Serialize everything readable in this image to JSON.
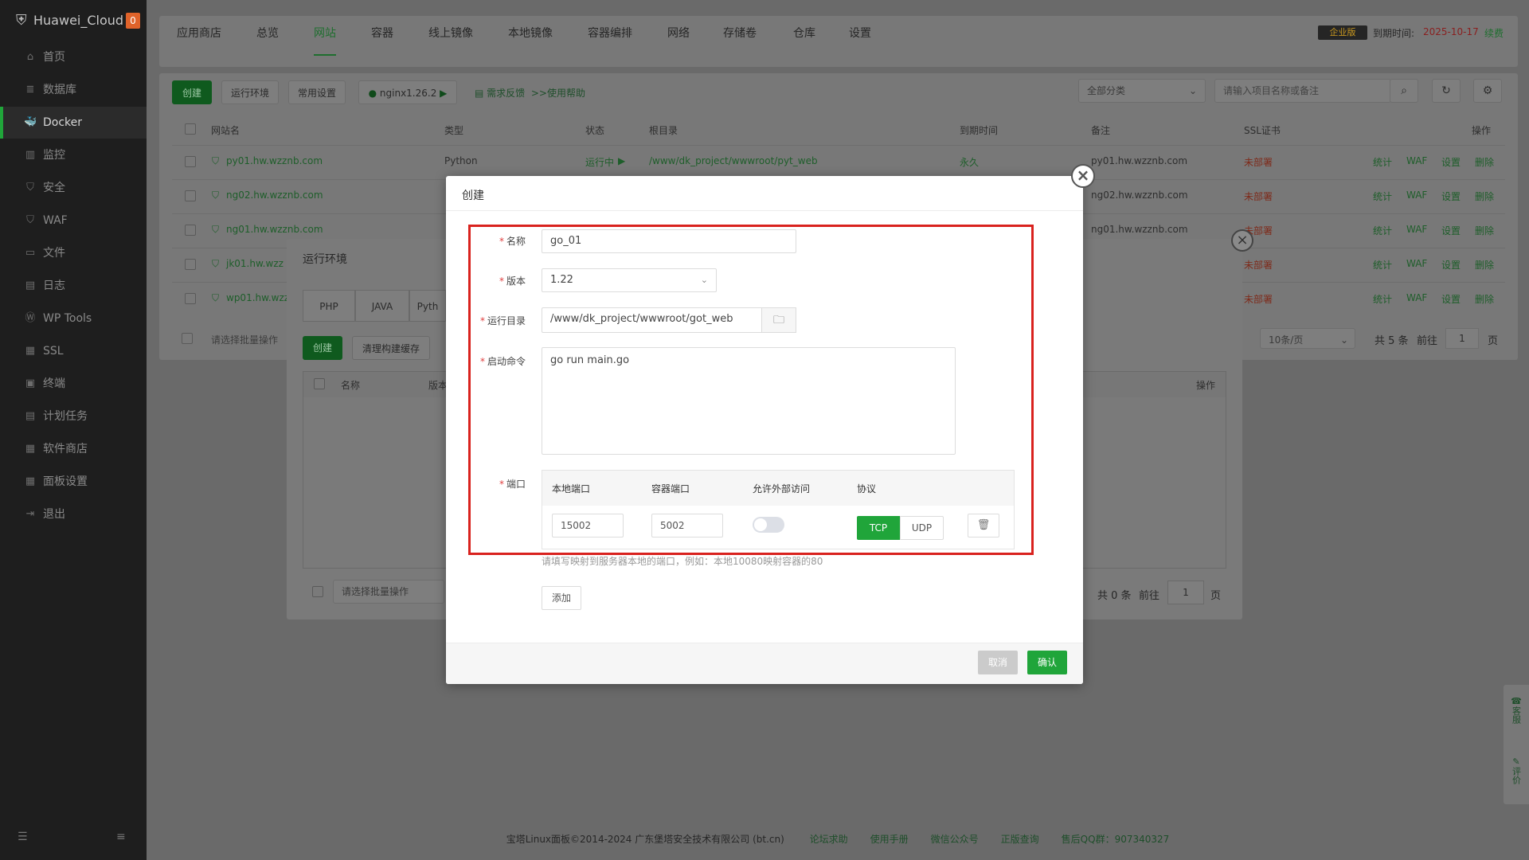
{
  "sidebar": {
    "app_name": "Huawei_Cloud",
    "badge": "0",
    "items": [
      {
        "label": "首页",
        "icon": "home-icon"
      },
      {
        "label": "数据库",
        "icon": "database-icon"
      },
      {
        "label": "Docker",
        "icon": "docker-icon"
      },
      {
        "label": "监控",
        "icon": "monitor-icon"
      },
      {
        "label": "安全",
        "icon": "shield-icon"
      },
      {
        "label": "WAF",
        "icon": "waf-icon"
      },
      {
        "label": "文件",
        "icon": "folder-icon"
      },
      {
        "label": "日志",
        "icon": "log-icon"
      },
      {
        "label": "WP Tools",
        "icon": "wordpress-icon"
      },
      {
        "label": "SSL",
        "icon": "ssl-icon"
      },
      {
        "label": "终端",
        "icon": "terminal-icon"
      },
      {
        "label": "计划任务",
        "icon": "schedule-icon"
      },
      {
        "label": "软件商店",
        "icon": "store-icon"
      },
      {
        "label": "面板设置",
        "icon": "settings-icon"
      },
      {
        "label": "退出",
        "icon": "logout-icon"
      }
    ],
    "active": "Docker"
  },
  "topbar": {
    "tabs": [
      "应用商店",
      "总览",
      "网站",
      "容器",
      "线上镜像",
      "本地镜像",
      "容器编排",
      "网络",
      "存储卷",
      "仓库",
      "设置"
    ],
    "active": "网站",
    "vip": "企业版",
    "expire_label": "到期时间:",
    "expire_date": "2025-10-17",
    "renew": "续费"
  },
  "toolbar": {
    "create": "创建",
    "run_env": "运行环境",
    "common_settings": "常用设置",
    "nginx": "nginx1.26.2",
    "feedback": "需求反馈",
    "help": ">>使用帮助",
    "category": "全部分类",
    "search_placeholder": "请输入项目名称或备注"
  },
  "site_table": {
    "headers": [
      "网站名",
      "类型",
      "状态",
      "根目录",
      "到期时间",
      "备注",
      "SSL证书",
      "操作"
    ],
    "rows": [
      {
        "name": "py01.hw.wzznb.com",
        "type": "Python",
        "status": "运行中",
        "root": "/www/dk_project/wwwroot/pyt_web",
        "expire": "永久",
        "remark": "py01.hw.wzznb.com",
        "ssl": "未部署"
      },
      {
        "name": "ng02.hw.wzznb.com",
        "remark": "ng02.hw.wzznb.com",
        "ssl": "未部署"
      },
      {
        "name": "ng01.hw.wzznb.com",
        "remark": "ng01.hw.wzznb.com",
        "ssl": "未部署"
      },
      {
        "name": "jk01.hw.wzz",
        "ssl": "未部署"
      },
      {
        "name": "wp01.hw.wzz",
        "ssl": "未部署"
      }
    ],
    "actions": [
      "统计",
      "WAF",
      "设置",
      "删除"
    ],
    "batch": "请选择批量操作",
    "page_size": "10条/页",
    "total": "共 5 条",
    "goto": "前往",
    "page": "1",
    "page_unit": "页"
  },
  "env_dialog": {
    "title": "运行环境",
    "tabs": [
      "PHP",
      "JAVA",
      "Pyth"
    ],
    "create": "创建",
    "clear_cache": "清理构建缓存",
    "col_name": "名称",
    "col_version": "版本",
    "col_action": "操作",
    "batch": "请选择批量操作",
    "total": "共 0 条",
    "goto": "前往",
    "page": "1",
    "page_unit": "页"
  },
  "modal": {
    "title": "创建",
    "name_label": "名称",
    "name_value": "go_01",
    "version_label": "版本",
    "version_value": "1.22",
    "dir_label": "运行目录",
    "dir_value": "/www/dk_project/wwwroot/got_web",
    "cmd_label": "启动命令",
    "cmd_value": "go run main.go",
    "port_label": "端口",
    "port_headers": [
      "本地端口",
      "容器端口",
      "允许外部访问",
      "协议"
    ],
    "local_port": "15002",
    "container_port": "5002",
    "external_access": false,
    "protocol_tcp": "TCP",
    "protocol_udp": "UDP",
    "protocol_selected": "TCP",
    "port_hint": "请填写映射到服务器本地的端口，例如：本地10080映射容器的80",
    "add": "添加",
    "cancel": "取消",
    "confirm": "确认"
  },
  "float": {
    "service": "客服",
    "review": "评价"
  },
  "footer": {
    "copyright": "宝塔Linux面板©2014-2024 广东堡塔安全技术有限公司 (bt.cn)",
    "links": [
      "论坛求助",
      "使用手册",
      "微信公众号",
      "正版查询",
      "售后QQ群：907340327"
    ]
  },
  "colors": {
    "accent": "#20a53a",
    "danger_outline": "#d9221e"
  }
}
